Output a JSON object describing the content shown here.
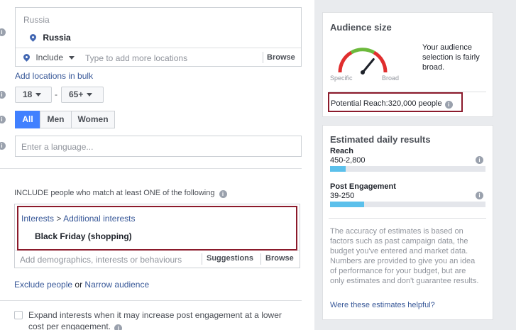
{
  "locations": {
    "header": "Russia",
    "selected": "Russia",
    "include_label": "Include",
    "input_placeholder": "Type to add more locations",
    "browse_label": "Browse",
    "bulk_link": "Add locations in bulk"
  },
  "age": {
    "min": "18",
    "separator": "-",
    "max": "65+"
  },
  "gender": {
    "options": [
      "All",
      "Men",
      "Women"
    ],
    "selected": "All"
  },
  "languages": {
    "placeholder": "Enter a language..."
  },
  "detailed_targeting": {
    "heading": "INCLUDE people who match at least ONE of the following",
    "path_interests": "Interests",
    "path_separator": ">",
    "path_additional": "Additional interests",
    "selected_interest": "Black Friday (shopping)",
    "input_placeholder": "Add demographics, interests or behaviours",
    "suggestions_label": "Suggestions",
    "browse_label": "Browse",
    "exclude_link": "Exclude people",
    "or_text": "or",
    "narrow_link": "Narrow audience",
    "expand_text": "Expand interests when it may increase post engagement at a lower cost per engagement."
  },
  "audience_size": {
    "title": "Audience size",
    "gauge_left": "Specific",
    "gauge_right": "Broad",
    "description": "Your audience selection is fairly broad.",
    "potential_reach_label": "Potential Reach:",
    "potential_reach_value": "320,000 people",
    "gauge_level": 0.72
  },
  "estimated": {
    "title": "Estimated daily results",
    "reach_label": "Reach",
    "reach_value": "450-2,800",
    "reach_fill": 0.1,
    "engagement_label": "Post Engagement",
    "engagement_value": "39-250",
    "engagement_fill": 0.22,
    "disclaimer": "The accuracy of estimates is based on factors such as past campaign data, the budget you've entered and market data. Numbers are provided to give you an idea of performance for your budget, but are only estimates and don't guarantee results.",
    "feedback_link": "Were these estimates helpful?"
  },
  "colors": {
    "link": "#385898",
    "accent_blue": "#4080ff",
    "highlight_frame": "#8b1a2b",
    "bar_fill": "#5bc0eb"
  }
}
